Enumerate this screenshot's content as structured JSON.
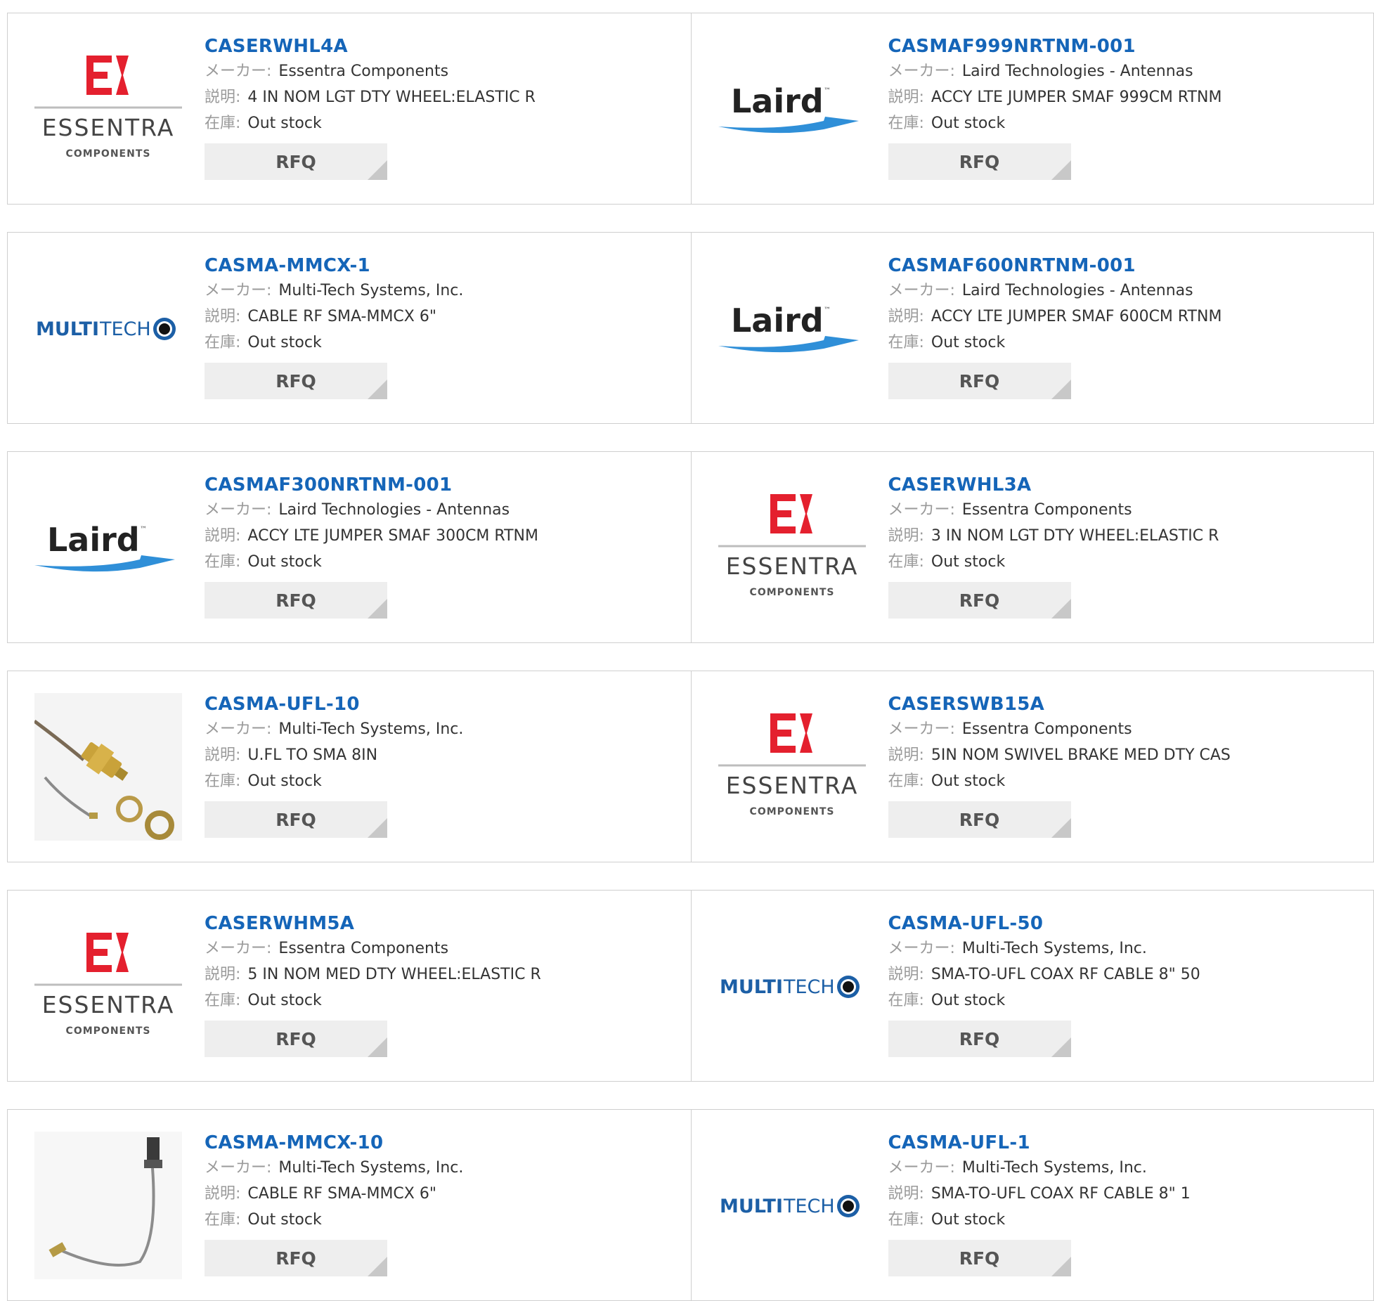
{
  "labels": {
    "maker": "メーカー:",
    "desc": "説明:",
    "stock": "在庫:",
    "rfq": "RFQ"
  },
  "logos": {
    "essentra": {
      "wordmark": "ESSENTRA",
      "sub": "COMPONENTS",
      "color": "#e4202e",
      "icon": "essentra-logo"
    },
    "laird": {
      "wordmark": "Laird",
      "tm": "™",
      "color": "#2f8fd8",
      "icon": "laird-logo"
    },
    "multitech": {
      "wordmark_bold": "MULTI",
      "wordmark_light": "TECH",
      "color": "#1c5fa6",
      "icon": "multitech-logo"
    },
    "cable": {
      "icon": "cable-product-photo"
    }
  },
  "colors": {
    "link": "#1565b8",
    "label": "#9a9a9a",
    "border": "#cfcfcf",
    "button_bg": "#eeeeee"
  },
  "products": [
    {
      "part": "CASERWHL4A",
      "maker": "Essentra Components",
      "desc": "4 IN NOM LGT DTY WHEEL:ELASTIC R",
      "stock": "Out stock",
      "logo": "essentra"
    },
    {
      "part": "CASMAF999NRTNM-001",
      "maker": "Laird Technologies - Antennas",
      "desc": "ACCY LTE JUMPER SMAF 999CM RTNM",
      "stock": "Out stock",
      "logo": "laird"
    },
    {
      "part": "CASMA-MMCX-1",
      "maker": "Multi-Tech Systems, Inc.",
      "desc": "CABLE RF SMA-MMCX 6\"",
      "stock": "Out stock",
      "logo": "multitech"
    },
    {
      "part": "CASMAF600NRTNM-001",
      "maker": "Laird Technologies - Antennas",
      "desc": "ACCY LTE JUMPER SMAF 600CM RTNM",
      "stock": "Out stock",
      "logo": "laird"
    },
    {
      "part": "CASMAF300NRTNM-001",
      "maker": "Laird Technologies - Antennas",
      "desc": "ACCY LTE JUMPER SMAF 300CM RTNM",
      "stock": "Out stock",
      "logo": "laird"
    },
    {
      "part": "CASERWHL3A",
      "maker": "Essentra Components",
      "desc": "3 IN NOM LGT DTY WHEEL:ELASTIC R",
      "stock": "Out stock",
      "logo": "essentra"
    },
    {
      "part": "CASMA-UFL-10",
      "maker": "Multi-Tech Systems, Inc.",
      "desc": "U.FL TO SMA 8IN",
      "stock": "Out stock",
      "logo": "cable"
    },
    {
      "part": "CASERSWB15A",
      "maker": "Essentra Components",
      "desc": "5IN NOM SWIVEL BRAKE MED DTY CAS",
      "stock": "Out stock",
      "logo": "essentra"
    },
    {
      "part": "CASERWHM5A",
      "maker": "Essentra Components",
      "desc": "5 IN NOM MED DTY WHEEL:ELASTIC R",
      "stock": "Out stock",
      "logo": "essentra"
    },
    {
      "part": "CASMA-UFL-50",
      "maker": "Multi-Tech Systems, Inc.",
      "desc": "SMA-TO-UFL COAX RF CABLE 8\" 50",
      "stock": "Out stock",
      "logo": "multitech"
    },
    {
      "part": "CASMA-MMCX-10",
      "maker": "Multi-Tech Systems, Inc.",
      "desc": "CABLE RF SMA-MMCX 6\"",
      "stock": "Out stock",
      "logo": "cable2"
    },
    {
      "part": "CASMA-UFL-1",
      "maker": "Multi-Tech Systems, Inc.",
      "desc": "SMA-TO-UFL COAX RF CABLE 8\" 1",
      "stock": "Out stock",
      "logo": "multitech"
    }
  ]
}
